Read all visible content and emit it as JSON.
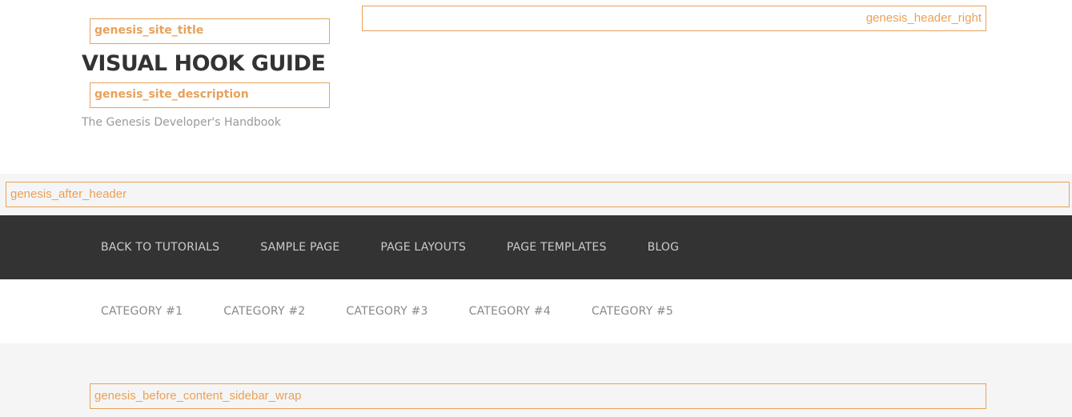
{
  "header": {
    "hook_site_title": "genesis_site_title",
    "title": "VISUAL HOOK GUIDE",
    "hook_site_description": "genesis_site_description",
    "description": "The Genesis Developer's Handbook",
    "hook_header_right": "genesis_header_right"
  },
  "after_header": {
    "hook_label": "genesis_after_header"
  },
  "primary_nav": {
    "items": [
      {
        "label": "BACK TO TUTORIALS"
      },
      {
        "label": "SAMPLE PAGE"
      },
      {
        "label": "PAGE LAYOUTS"
      },
      {
        "label": "PAGE TEMPLATES"
      },
      {
        "label": "BLOG"
      }
    ]
  },
  "secondary_nav": {
    "items": [
      {
        "label": "CATEGORY #1"
      },
      {
        "label": "CATEGORY #2"
      },
      {
        "label": "CATEGORY #3"
      },
      {
        "label": "CATEGORY #4"
      },
      {
        "label": "CATEGORY #5"
      }
    ]
  },
  "content": {
    "hook_before_content": "genesis_before_content_sidebar_wrap"
  },
  "colors": {
    "hook_accent": "#e8a15a",
    "nav_background": "#333333",
    "band_background": "#f5f5f5"
  }
}
